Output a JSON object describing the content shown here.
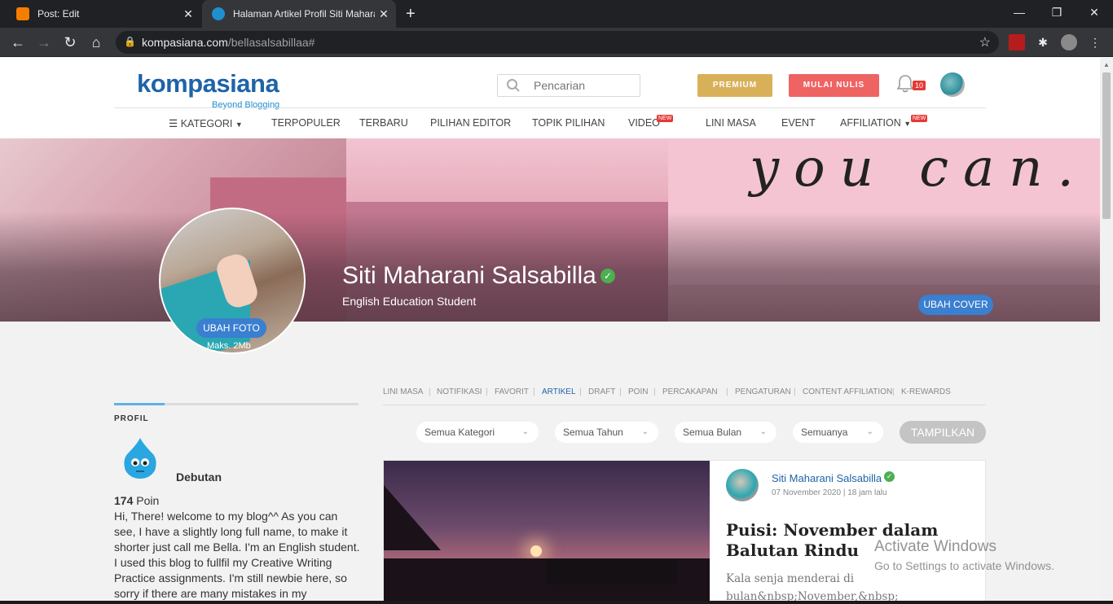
{
  "browser": {
    "tabs": [
      {
        "title": "Post: Edit",
        "active": false
      },
      {
        "title": "Halaman Artikel Profil Siti Maharani Salsabilla",
        "active": true
      }
    ],
    "url_domain": "kompasiana.com",
    "url_path": "/bellasalsabillaa#",
    "colors": {
      "blogger": "#f57d00",
      "kompasiana_tab": "#1f8fd0"
    }
  },
  "header": {
    "logo_text": "kompasiana",
    "logo_tagline": "Beyond Blogging",
    "search_placeholder": "Pencarian",
    "premium_label": "PREMIUM",
    "write_label": "MULAI NULIS",
    "notification_count": "10"
  },
  "menu": {
    "items": [
      {
        "label": "KATEGORI",
        "new": false
      },
      {
        "label": "TERPOPULER",
        "new": false
      },
      {
        "label": "TERBARU",
        "new": false
      },
      {
        "label": "PILIHAN EDITOR",
        "new": false
      },
      {
        "label": "TOPIK PILIHAN",
        "new": false
      },
      {
        "label": "VIDEO",
        "new": true
      },
      {
        "label": "LINI MASA",
        "new": false
      },
      {
        "label": "EVENT",
        "new": false
      },
      {
        "label": "AFFILIATION",
        "new": true
      }
    ],
    "new_badge": "NEW"
  },
  "cover": {
    "script_text": "you can.",
    "change_cover_label": "UBAH COVER"
  },
  "profile": {
    "name": "Siti Maharani Salsabilla",
    "bio": "English Education Student",
    "change_photo_label": "UBAH FOTO",
    "photo_limit": "Maks. 2Mb"
  },
  "sidebar": {
    "section_title": "PROFIL",
    "rank": "Debutan",
    "points_value": "174",
    "points_label": "Poin",
    "about": "Hi, There! welcome to my blog^^ As you can see, I have a slightly long full name, to make it shorter just call me Bella. I'm an English student. I used this blog to fullfil my Creative Writing Practice assignments. I'm still newbie here, so sorry if there are many mistakes in my"
  },
  "subnav": {
    "items": [
      "LINI MASA",
      "NOTIFIKASI",
      "FAVORIT",
      "ARTIKEL",
      "DRAFT",
      "POIN",
      "PERCAKAPAN",
      "PENGATURAN",
      "CONTENT AFFILIATION",
      "K-REWARDS"
    ],
    "active": "ARTIKEL"
  },
  "filters": {
    "kategori": "Semua Kategori",
    "tahun": "Semua Tahun",
    "bulan": "Semua Bulan",
    "jenis": "Semuanya",
    "submit_label": "TAMPILKAN"
  },
  "article": {
    "author": "Siti Maharani Salsabilla",
    "date": "07 November 2020 | 18 jam lalu",
    "title": "Puisi: November dalam Balutan Rindu",
    "excerpt": "Kala senja menderai di bulan&nbsp;November,&nbsp;"
  },
  "watermark": {
    "line1": "Activate Windows",
    "line2": "Go to Settings to activate Windows."
  }
}
